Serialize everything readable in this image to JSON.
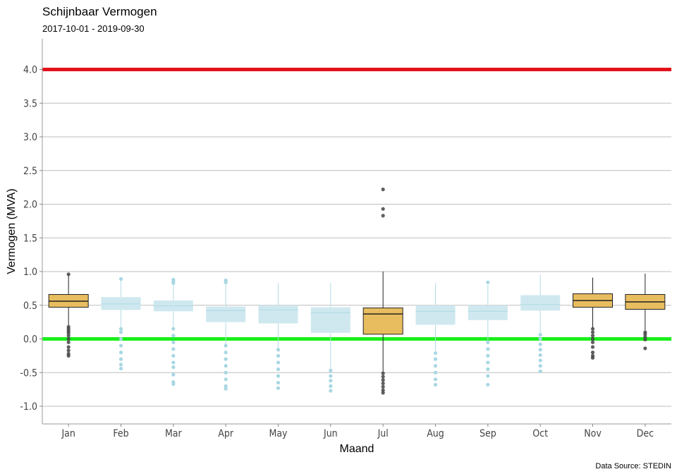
{
  "chart_data": {
    "type": "box",
    "title": "Schijnbaar Vermogen",
    "subtitle": "2017-10-01 - 2019-09-30",
    "xlabel": "Maand",
    "ylabel": "Vermogen (MVA)",
    "caption": "Data Source: STEDIN",
    "ylim": [
      -1.25,
      4.45
    ],
    "yticks": [
      "-1.0",
      "-0.5",
      "0.0",
      "0.5",
      "1.0",
      "1.5",
      "2.0",
      "2.5",
      "3.0",
      "3.5",
      "4.0"
    ],
    "reference_lines": [
      {
        "y": 4.0,
        "color": "#e3121b"
      },
      {
        "y": 0.0,
        "color": "#19ef1b"
      }
    ],
    "colors": {
      "highlight_fill": "#e8bd5f",
      "highlight_line": "#222222",
      "muted_fill": "#cfe8ef",
      "muted_line": "#b3dbe5",
      "grid": "#bdbdbd"
    },
    "categories": [
      "Jan",
      "Feb",
      "Mar",
      "Apr",
      "May",
      "Jun",
      "Jul",
      "Aug",
      "Sep",
      "Oct",
      "Nov",
      "Dec"
    ],
    "boxes": [
      {
        "month": "Jan",
        "highlight": true,
        "whisker_low": 0.2,
        "q1": 0.47,
        "median": 0.56,
        "q3": 0.66,
        "whisker_high": 0.96,
        "outliers": [
          0.96,
          0.18,
          0.15,
          0.12,
          0.09,
          0.05,
          0.0,
          -0.05,
          -0.12,
          -0.17,
          -0.22,
          -0.25
        ]
      },
      {
        "month": "Feb",
        "highlight": false,
        "whisker_low": 0.15,
        "q1": 0.43,
        "median": 0.52,
        "q3": 0.62,
        "whisker_high": 0.88,
        "outliers": [
          0.89,
          0.15,
          0.1,
          0.0,
          -0.1,
          -0.2,
          -0.3,
          -0.38,
          -0.44
        ]
      },
      {
        "month": "Mar",
        "highlight": false,
        "whisker_low": 0.15,
        "q1": 0.41,
        "median": 0.49,
        "q3": 0.57,
        "whisker_high": 0.82,
        "outliers": [
          0.88,
          0.85,
          0.83,
          0.15,
          0.05,
          -0.05,
          -0.15,
          -0.25,
          -0.35,
          -0.42,
          -0.53,
          -0.64,
          -0.67
        ]
      },
      {
        "month": "Apr",
        "highlight": false,
        "whisker_low": -0.08,
        "q1": 0.25,
        "median": 0.42,
        "q3": 0.48,
        "whisker_high": 0.83,
        "outliers": [
          0.87,
          0.84,
          -0.1,
          -0.2,
          -0.3,
          -0.4,
          -0.5,
          -0.6,
          -0.7,
          -0.74
        ]
      },
      {
        "month": "May",
        "highlight": false,
        "whisker_low": -0.15,
        "q1": 0.23,
        "median": 0.43,
        "q3": 0.5,
        "whisker_high": 0.83,
        "outliers": [
          -0.16,
          -0.25,
          -0.35,
          -0.45,
          -0.55,
          -0.65,
          -0.73
        ]
      },
      {
        "month": "Jun",
        "highlight": false,
        "whisker_low": -0.45,
        "q1": 0.09,
        "median": 0.39,
        "q3": 0.47,
        "whisker_high": 0.83,
        "outliers": [
          -0.47,
          -0.55,
          -0.62,
          -0.7,
          -0.77
        ]
      },
      {
        "month": "Jul",
        "highlight": true,
        "whisker_low": -0.49,
        "q1": 0.07,
        "median": 0.37,
        "q3": 0.46,
        "whisker_high": 1.0,
        "outliers": [
          2.22,
          1.93,
          1.83,
          -0.51,
          -0.56,
          -0.61,
          -0.66,
          -0.71,
          -0.76,
          -0.8
        ]
      },
      {
        "month": "Aug",
        "highlight": false,
        "whisker_low": -0.18,
        "q1": 0.21,
        "median": 0.41,
        "q3": 0.5,
        "whisker_high": 0.83,
        "outliers": [
          -0.21,
          -0.3,
          -0.4,
          -0.5,
          -0.6,
          -0.68
        ]
      },
      {
        "month": "Sep",
        "highlight": false,
        "whisker_low": -0.05,
        "q1": 0.28,
        "median": 0.41,
        "q3": 0.5,
        "whisker_high": 0.8,
        "outliers": [
          0.84,
          -0.05,
          -0.15,
          -0.25,
          -0.35,
          -0.45,
          -0.55,
          -0.68
        ]
      },
      {
        "month": "Oct",
        "highlight": false,
        "whisker_low": 0.06,
        "q1": 0.42,
        "median": 0.51,
        "q3": 0.65,
        "whisker_high": 0.95,
        "outliers": [
          0.06,
          0.0,
          -0.08,
          -0.16,
          -0.24,
          -0.32,
          -0.4,
          -0.48
        ]
      },
      {
        "month": "Nov",
        "highlight": true,
        "whisker_low": 0.15,
        "q1": 0.47,
        "median": 0.57,
        "q3": 0.67,
        "whisker_high": 0.91,
        "outliers": [
          0.15,
          0.1,
          0.05,
          0.0,
          -0.05,
          -0.12,
          -0.2,
          -0.25,
          -0.28
        ]
      },
      {
        "month": "Dec",
        "highlight": true,
        "whisker_low": 0.13,
        "q1": 0.44,
        "median": 0.55,
        "q3": 0.66,
        "whisker_high": 0.97,
        "outliers": [
          0.1,
          0.07,
          0.03,
          -0.01,
          -0.14
        ]
      }
    ]
  }
}
